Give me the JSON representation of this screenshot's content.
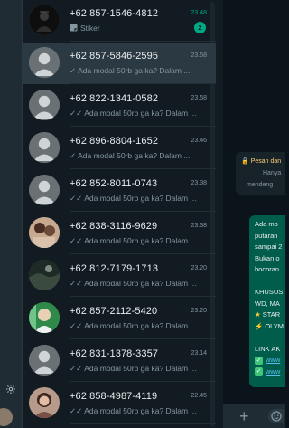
{
  "chats": [
    {
      "name": "+62 857-1546-4812",
      "time": "23.48",
      "preview": "Stiker",
      "preview_icon": "sticker-icon",
      "unread": "2",
      "active": false,
      "avatar": "dark-photo"
    },
    {
      "name": "+62 857-5846-2595",
      "time": "23.58",
      "preview": "Ada modal 50rb ga ka? Dalam ...",
      "ticks": "✓",
      "active": true,
      "avatar": "default"
    },
    {
      "name": "+62 822-1341-0582",
      "time": "23.58",
      "preview": "Ada modal 50rb ga ka? Dalam ...",
      "ticks": "✓✓",
      "avatar": "default"
    },
    {
      "name": "+62 896-8804-1652",
      "time": "23.46",
      "preview": "Ada modal 50rb ga ka? Dalam ...",
      "ticks": "✓",
      "avatar": "default"
    },
    {
      "name": "+62 852-8011-0743",
      "time": "23.38",
      "preview": "Ada modal 50rb ga ka? Dalam ...",
      "ticks": "✓✓",
      "avatar": "default"
    },
    {
      "name": "+62 838-3116-9629",
      "time": "23.38",
      "preview": "Ada modal 50rb ga ka? Dalam ...",
      "ticks": "✓✓",
      "avatar": "photo-people"
    },
    {
      "name": "+62 812-7179-1713",
      "time": "23.20",
      "preview": "Ada modal 50rb ga ka? Dalam ...",
      "ticks": "✓✓",
      "avatar": "photo-dark-scene"
    },
    {
      "name": "+62 857-2112-5420",
      "time": "23.20",
      "preview": "Ada modal 50rb ga ka? Dalam ...",
      "ticks": "✓✓",
      "avatar": "photo-green"
    },
    {
      "name": "+62 831-1378-3357",
      "time": "23.14",
      "preview": "Ada modal 50rb ga ka? Dalam ...",
      "ticks": "✓✓",
      "avatar": "default"
    },
    {
      "name": "+62 858-4987-4119",
      "time": "22.45",
      "preview": "Ada modal 50rb ga ka? Dalam ...",
      "ticks": "✓✓",
      "avatar": "photo-woman"
    }
  ],
  "conversation": {
    "encryption_note": {
      "line1": "Pesan dan",
      "line2": "Hanya",
      "line3": "mendeng"
    },
    "message_lines": [
      "Ada mo",
      "putaran",
      "sampai 2",
      "Bukan o",
      "bocoran",
      "",
      "KHUSUS",
      "WD, MA",
      "STAR",
      "OLYM",
      "",
      "LINK AK",
      "www",
      "www"
    ]
  },
  "colors": {
    "accent": "#00a884",
    "bubble": "#005c4b",
    "panel": "#111b21",
    "selected": "#2a3942"
  }
}
